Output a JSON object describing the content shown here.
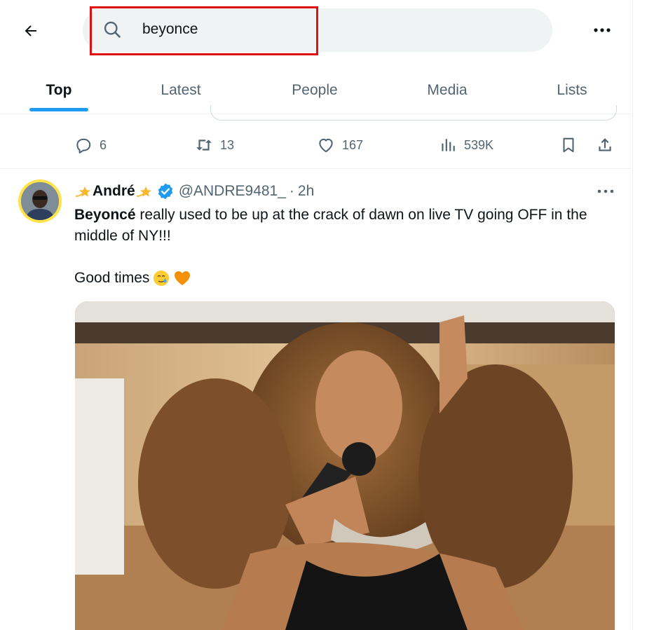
{
  "search": {
    "query": "beyonce"
  },
  "tabs": [
    {
      "label": "Top",
      "active": true
    },
    {
      "label": "Latest"
    },
    {
      "label": "People"
    },
    {
      "label": "Media"
    },
    {
      "label": "Lists"
    }
  ],
  "prev_tweet": {
    "stats": {
      "replies": "6",
      "retweets": "13",
      "likes": "167",
      "views": "539K"
    }
  },
  "tweet": {
    "display_name": "André",
    "handle": "@ANDRE9481_",
    "separator": "·",
    "time": "2h",
    "text_bold": "Beyoncé",
    "text_rest": " really used to be up at the crack of dawn on live TV going OFF in the middle of NY!!!",
    "text_line2": "Good times"
  },
  "colors": {
    "accent": "#1d9bf0",
    "highlight_box": "#e01010",
    "secondary_text": "#536471",
    "avatar_ring": "#ffe34a"
  },
  "icons": [
    "back-arrow-icon",
    "search-icon",
    "more-icon",
    "reply-icon",
    "retweet-icon",
    "like-icon",
    "views-icon",
    "bookmark-icon",
    "share-icon",
    "verified-badge-icon",
    "dizzy-star-icon"
  ]
}
